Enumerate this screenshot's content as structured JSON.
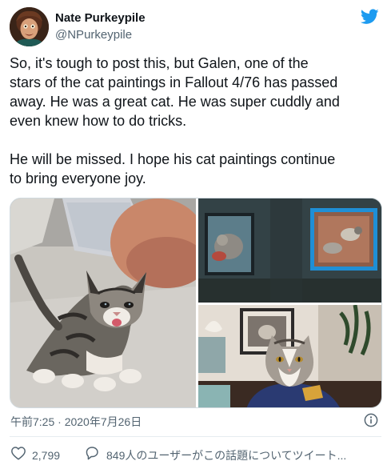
{
  "author": {
    "display_name": "Nate Purkeypile",
    "handle": "@NPurkeypile",
    "avatar_icon": "avatar-illustration",
    "logo_icon": "twitter-bird-icon",
    "brand_color": "#1d9bf0"
  },
  "tweet": {
    "lines": [
      "So, it's tough to post this, but Galen, one of the",
      "stars of the cat paintings in Fallout 4/76 has passed",
      "away. He was a great cat. He was super cuddly and",
      "even knew how to do tricks.",
      "He will be missed. I hope his cat paintings continue",
      "to bring everyone joy."
    ],
    "media": [
      {
        "subject": "tabby kitten"
      },
      {
        "subject": "cat paintings in game"
      },
      {
        "subject": "adult cat on blue cloth"
      }
    ]
  },
  "meta": {
    "timestamp": "午前7:25 · 2020年7月26日",
    "info_icon": "info-icon"
  },
  "actions": {
    "like_count": "2,799",
    "like_icon": "heart-icon",
    "reply_icon": "speech-bubble-icon",
    "reply_label": "849人のユーザーがこの話題についてツイート..."
  }
}
